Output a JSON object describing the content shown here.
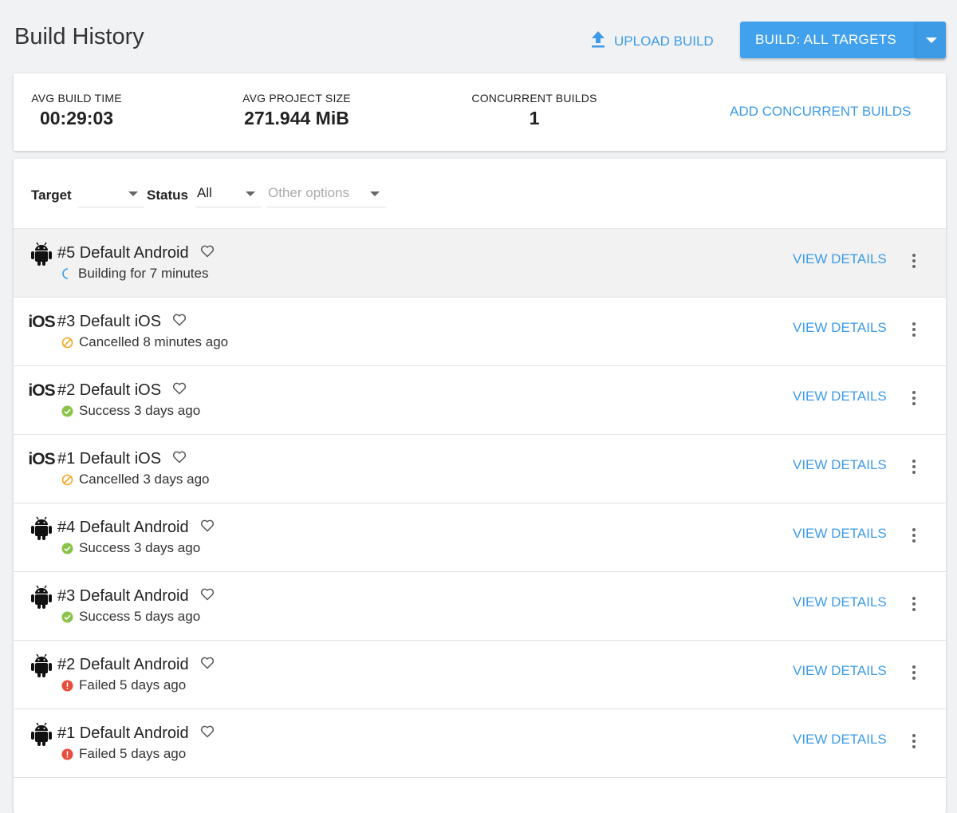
{
  "header": {
    "title": "Build History",
    "upload_label": "UPLOAD BUILD",
    "build_label": "BUILD: ALL TARGETS"
  },
  "stats": {
    "avg_build_time_label": "AVG BUILD TIME",
    "avg_build_time": "00:29:03",
    "avg_size_label": "AVG PROJECT SIZE",
    "avg_size": "271.944 MiB",
    "concurrent_label": "CONCURRENT BUILDS",
    "concurrent": "1",
    "add_concurrent_label": "ADD CONCURRENT BUILDS"
  },
  "filters": {
    "target_label": "Target",
    "target_value": "",
    "status_label": "Status",
    "status_value": "All",
    "other_placeholder": "Other options"
  },
  "colors": {
    "accent": "#3d9be9",
    "success": "#8bc34a",
    "cancelled": "#f5a623",
    "failed": "#e74c3c"
  },
  "builds": [
    {
      "platform": "android",
      "title": "#5 Default Android",
      "status": "building",
      "status_text": "Building for 7 minutes",
      "action": "VIEW DETAILS"
    },
    {
      "platform": "ios",
      "platform_label": "iOS",
      "title": "#3 Default iOS",
      "status": "cancelled",
      "status_text": "Cancelled 8 minutes ago",
      "action": "VIEW DETAILS"
    },
    {
      "platform": "ios",
      "platform_label": "iOS",
      "title": "#2 Default iOS",
      "status": "success",
      "status_text": "Success 3 days ago",
      "action": "VIEW DETAILS"
    },
    {
      "platform": "ios",
      "platform_label": "iOS",
      "title": "#1 Default iOS",
      "status": "cancelled",
      "status_text": "Cancelled 3 days ago",
      "action": "VIEW DETAILS"
    },
    {
      "platform": "android",
      "title": "#4 Default Android",
      "status": "success",
      "status_text": "Success 3 days ago",
      "action": "VIEW DETAILS"
    },
    {
      "platform": "android",
      "title": "#3 Default Android",
      "status": "success",
      "status_text": "Success 5 days ago",
      "action": "VIEW DETAILS"
    },
    {
      "platform": "android",
      "title": "#2 Default Android",
      "status": "failed",
      "status_text": "Failed 5 days ago",
      "action": "VIEW DETAILS"
    },
    {
      "platform": "android",
      "title": "#1 Default Android",
      "status": "failed",
      "status_text": "Failed 5 days ago",
      "action": "VIEW DETAILS"
    }
  ]
}
